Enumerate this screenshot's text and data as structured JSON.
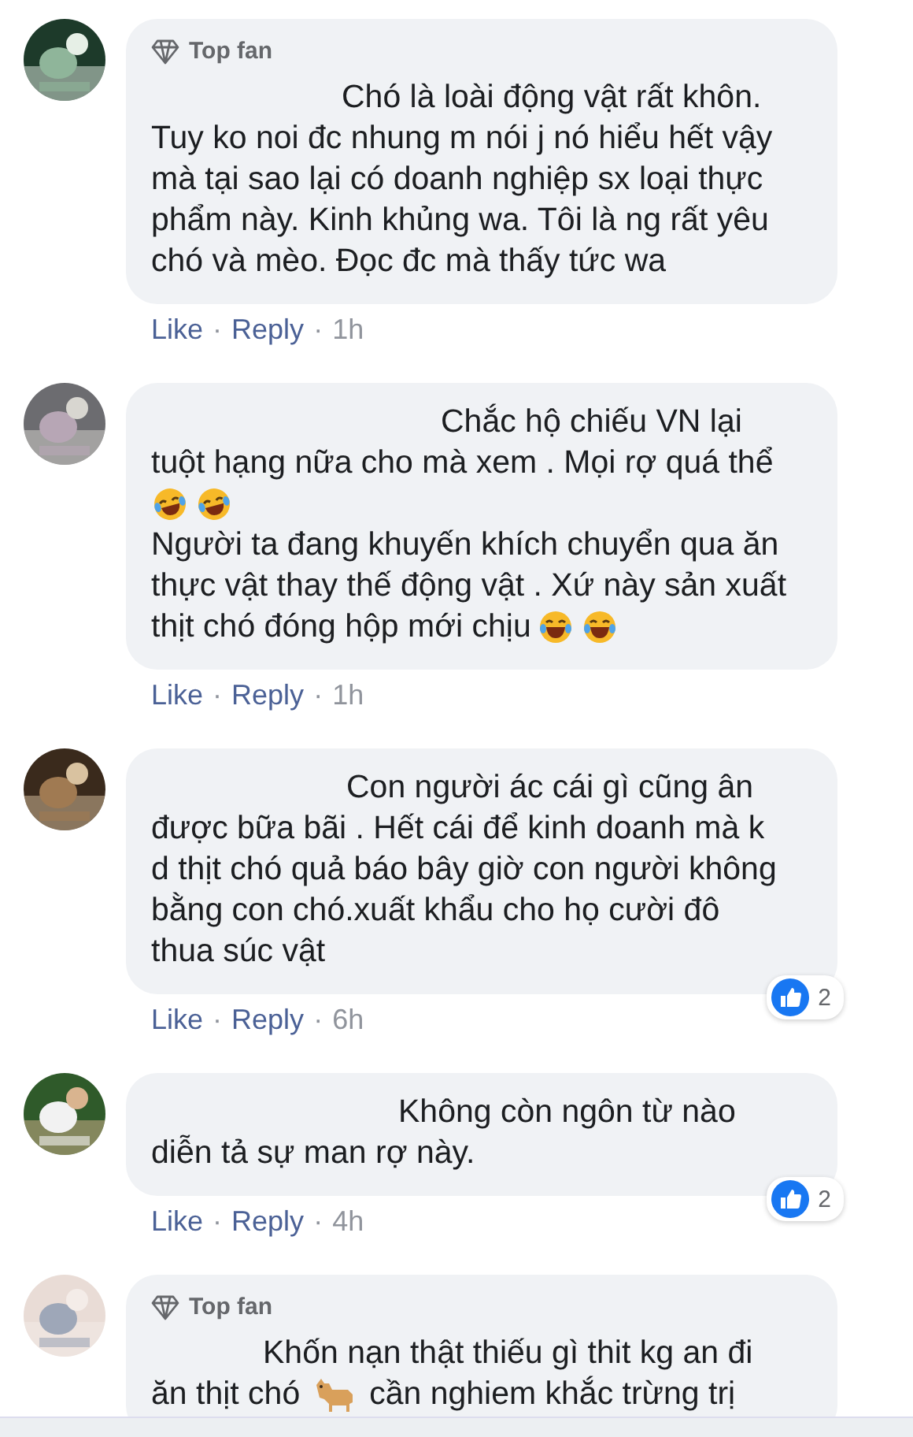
{
  "comments": [
    {
      "avatar": {
        "kind": "picture"
      },
      "top_fan": {
        "label": "Top fan"
      },
      "lines": [
        {
          "text": "Chó là loài động vật rất khôn."
        },
        {
          "text": "Tuy ko noi đc nhung m nói j nó hiểu hết vậy"
        },
        {
          "text": "mà tại sao lại có doanh nghiệp sx loại thực"
        },
        {
          "text": "phẩm này. Kinh khủng wa. Tôi là ng rất yêu"
        },
        {
          "text": "chó và mèo. Đọc đc mà thấy tức wa"
        }
      ],
      "actions": [
        {
          "kind": "link",
          "text": "Like"
        },
        {
          "kind": "separator",
          "text": "·"
        },
        {
          "kind": "link",
          "text": "Reply"
        },
        {
          "kind": "separator",
          "text": "·"
        },
        {
          "kind": "time",
          "text": "1h"
        }
      ]
    },
    {
      "avatar": {
        "kind": "picture"
      },
      "lines": [
        {
          "text": "Chắc hộ chiếu VN lại"
        },
        {
          "text": "tuột hạng nữa cho mà xem . Mọi rợ quá thể"
        },
        {
          "emojis": [
            {
              "kind": "laugh-tears"
            },
            {
              "kind": "laugh-tears"
            }
          ]
        },
        {
          "text": "Người ta đang khuyến khích chuyển qua ăn"
        },
        {
          "text": "thực vật thay thế động vật . Xứ này sản xuất"
        },
        {
          "text": "thịt chó đóng hộp mới chịu",
          "emojis": [
            {
              "kind": "joy"
            },
            {
              "kind": "joy"
            }
          ]
        }
      ],
      "actions": [
        {
          "kind": "link",
          "text": "Like"
        },
        {
          "kind": "separator",
          "text": "·"
        },
        {
          "kind": "link",
          "text": "Reply"
        },
        {
          "kind": "separator",
          "text": "·"
        },
        {
          "kind": "time",
          "text": "1h"
        }
      ]
    },
    {
      "avatar": {
        "kind": "picture"
      },
      "lines": [
        {
          "text": "Con người ác cái gì cũng ân"
        },
        {
          "text": "được bữa bãi . Hết cái để kinh doanh mà k"
        },
        {
          "text": "d thịt chó quả báo bây giờ con người không"
        },
        {
          "text": "bằng con chó.xuất khẩu cho họ cười đô"
        },
        {
          "text": "thua súc vật"
        }
      ],
      "reactions": {
        "count": "2"
      },
      "actions": [
        {
          "kind": "link",
          "text": "Like"
        },
        {
          "kind": "separator",
          "text": "·"
        },
        {
          "kind": "link",
          "text": "Reply"
        },
        {
          "kind": "separator",
          "text": "·"
        },
        {
          "kind": "time",
          "text": "6h"
        }
      ]
    },
    {
      "avatar": {
        "kind": "picture"
      },
      "lines": [
        {
          "text": "Không còn ngôn từ nào"
        },
        {
          "text": "diễn tả sự man rợ này."
        }
      ],
      "reactions": {
        "count": "2"
      },
      "actions": [
        {
          "kind": "link",
          "text": "Like"
        },
        {
          "kind": "separator",
          "text": "·"
        },
        {
          "kind": "link",
          "text": "Reply"
        },
        {
          "kind": "separator",
          "text": "·"
        },
        {
          "kind": "time",
          "text": "4h"
        }
      ]
    },
    {
      "avatar": {
        "kind": "picture"
      },
      "top_fan": {
        "label": "Top fan"
      },
      "lines": [
        {
          "text": "Khốn nạn thật thiếu gì thit kg an đi"
        },
        {
          "text": "ăn thịt chó",
          "emojis": [
            {
              "kind": "dog"
            }
          ],
          "after": "cần nghiem khắc trừng trị"
        }
      ]
    }
  ]
}
